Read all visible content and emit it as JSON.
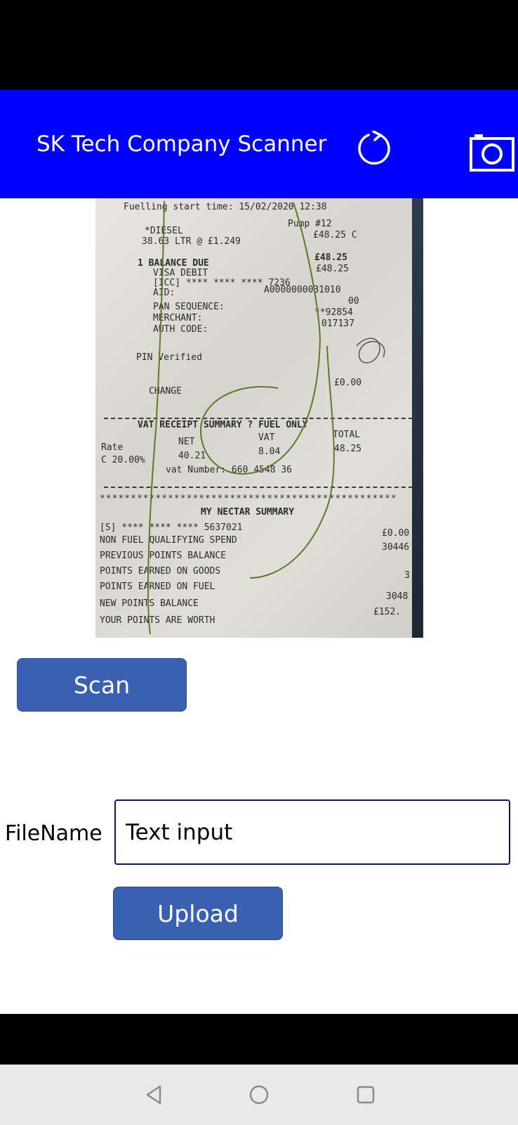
{
  "header": {
    "title": "SK Tech Company Scanner",
    "refresh_icon": "refresh-icon",
    "camera_icon": "camera-icon",
    "background": "#0000ff"
  },
  "receipt": {
    "lines": {
      "fuel_start": "Fuelling start time: 15/02/2020 12:38",
      "diesel": "*DIESEL",
      "pump": "Pump #12",
      "litres": "38.63 LTR @ £1.249",
      "price": "£48.25 C",
      "balance_due": "1 BALANCE DUE",
      "balance_amt": "£48.25",
      "visa": "VISA DEBIT",
      "visa_amt": "£48.25",
      "icc": "[ICC] **** **** **** 7236",
      "aid": "AID:",
      "aid_val": "A0000000031010",
      "pan_seq": "PAN SEQUENCE:",
      "pan_val": "00",
      "merchant": "MERCHANT:",
      "merchant_val": "**92854",
      "auth": "AUTH CODE:",
      "auth_val": "017137",
      "pin": "PIN Verified",
      "change": "CHANGE",
      "change_amt": "£0.00",
      "vat_summary": "VAT RECEIPT SUMMARY ? FUEL ONLY",
      "rate": "Rate",
      "net": "NET",
      "vat": "VAT",
      "total": "TOTAL",
      "rate_val": "C 20.00%",
      "net_val": "40.21",
      "vat_val": "8.04",
      "total_val": "48.25",
      "vat_number": "vat Number: 660 4548 36",
      "nectar": "MY NECTAR SUMMARY",
      "card": "[S] **** **** **** 5637021",
      "non_fuel": "NON FUEL QUALIFYING SPEND",
      "non_fuel_val": "£0.00",
      "prev_points": "PREVIOUS POINTS BALANCE",
      "prev_val": "30446",
      "earned_goods": "POINTS EARNED ON GOODS",
      "earned_fuel": "POINTS EARNED ON FUEL",
      "earned_fuel_val": "3",
      "new_balance": "NEW POINTS BALANCE",
      "new_balance_val": "3048",
      "worth": "YOUR POINTS ARE WORTH",
      "worth_val": "£152."
    }
  },
  "scan_button": {
    "label": "Scan"
  },
  "filename": {
    "label": "FileName",
    "value": "Text input"
  },
  "upload_button": {
    "label": "Upload"
  },
  "nav": {
    "back_icon": "back-triangle-icon",
    "home_icon": "home-circle-icon",
    "recents_icon": "recents-square-icon"
  }
}
